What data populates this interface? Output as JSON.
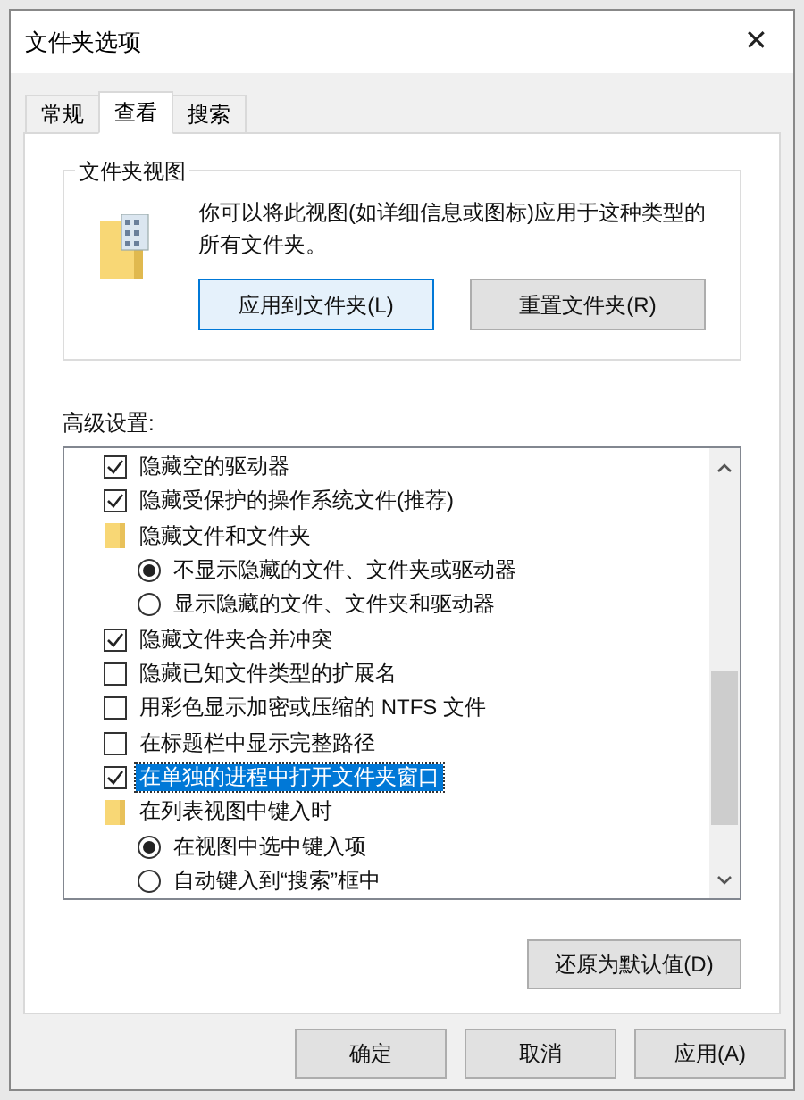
{
  "window": {
    "title": "文件夹选项",
    "close": "✕"
  },
  "tabs": [
    {
      "label": "常规",
      "selected": false
    },
    {
      "label": "查看",
      "selected": true
    },
    {
      "label": "搜索",
      "selected": false
    }
  ],
  "folder_views": {
    "title": "文件夹视图",
    "description": "你可以将此视图(如详细信息或图标)应用于这种类型的所有文件夹。",
    "buttons": [
      {
        "label": "应用到文件夹(L)",
        "focused": true
      },
      {
        "label": "重置文件夹(R)",
        "focused": false
      }
    ]
  },
  "advanced": {
    "label": "高级设置:",
    "items": [
      {
        "kind": "checkbox",
        "label": "隐藏空的驱动器",
        "checked": true,
        "selected": false
      },
      {
        "kind": "checkbox",
        "label": "隐藏受保护的操作系统文件(推荐)",
        "checked": true,
        "selected": false
      },
      {
        "kind": "folder",
        "label": "隐藏文件和文件夹",
        "selected": false
      },
      {
        "kind": "radio",
        "label": "不显示隐藏的文件、文件夹或驱动器",
        "checked": true,
        "selected": false
      },
      {
        "kind": "radio",
        "label": "显示隐藏的文件、文件夹和驱动器",
        "checked": false,
        "selected": false
      },
      {
        "kind": "checkbox",
        "label": "隐藏文件夹合并冲突",
        "checked": true,
        "selected": false
      },
      {
        "kind": "checkbox",
        "label": "隐藏已知文件类型的扩展名",
        "checked": false,
        "selected": false
      },
      {
        "kind": "checkbox",
        "label": "用彩色显示加密或压缩的 NTFS 文件",
        "checked": false,
        "selected": false
      },
      {
        "kind": "checkbox",
        "label": "在标题栏中显示完整路径",
        "checked": false,
        "selected": false
      },
      {
        "kind": "checkbox",
        "label": "在单独的进程中打开文件夹窗口",
        "checked": true,
        "selected": true
      },
      {
        "kind": "folder",
        "label": "在列表视图中键入时",
        "selected": false
      },
      {
        "kind": "radio",
        "label": "在视图中选中键入项",
        "checked": true,
        "selected": false
      },
      {
        "kind": "radio",
        "label": "自动键入到“搜索”框中",
        "checked": false,
        "selected": false
      }
    ],
    "restore_button": "还原为默认值(D)"
  },
  "buttons": [
    "确定",
    "取消",
    "应用(A)"
  ]
}
